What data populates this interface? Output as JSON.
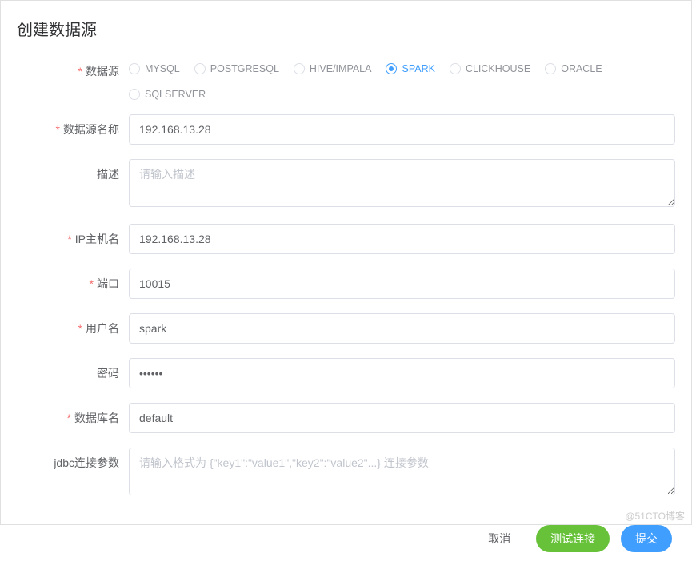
{
  "modal": {
    "title": "创建数据源"
  },
  "form": {
    "datasource": {
      "label": "数据源",
      "selected": "SPARK",
      "options": [
        "MYSQL",
        "POSTGRESQL",
        "HIVE/IMPALA",
        "SPARK",
        "CLICKHOUSE",
        "ORACLE",
        "SQLSERVER"
      ]
    },
    "name": {
      "label": "数据源名称",
      "value": "192.168.13.28"
    },
    "description": {
      "label": "描述",
      "placeholder": "请输入描述",
      "value": ""
    },
    "ip": {
      "label": "IP主机名",
      "value": "192.168.13.28"
    },
    "port": {
      "label": "端口",
      "value": "10015"
    },
    "username": {
      "label": "用户名",
      "value": "spark"
    },
    "password": {
      "label": "密码",
      "value": "••••••"
    },
    "dbname": {
      "label": "数据库名",
      "value": "default"
    },
    "jdbc": {
      "label": "jdbc连接参数",
      "placeholder": "请输入格式为 {\"key1\":\"value1\",\"key2\":\"value2\"...} 连接参数",
      "value": ""
    }
  },
  "footer": {
    "cancel": "取消",
    "test": "测试连接",
    "submit": "提交"
  },
  "watermark": "@51CTO博客"
}
